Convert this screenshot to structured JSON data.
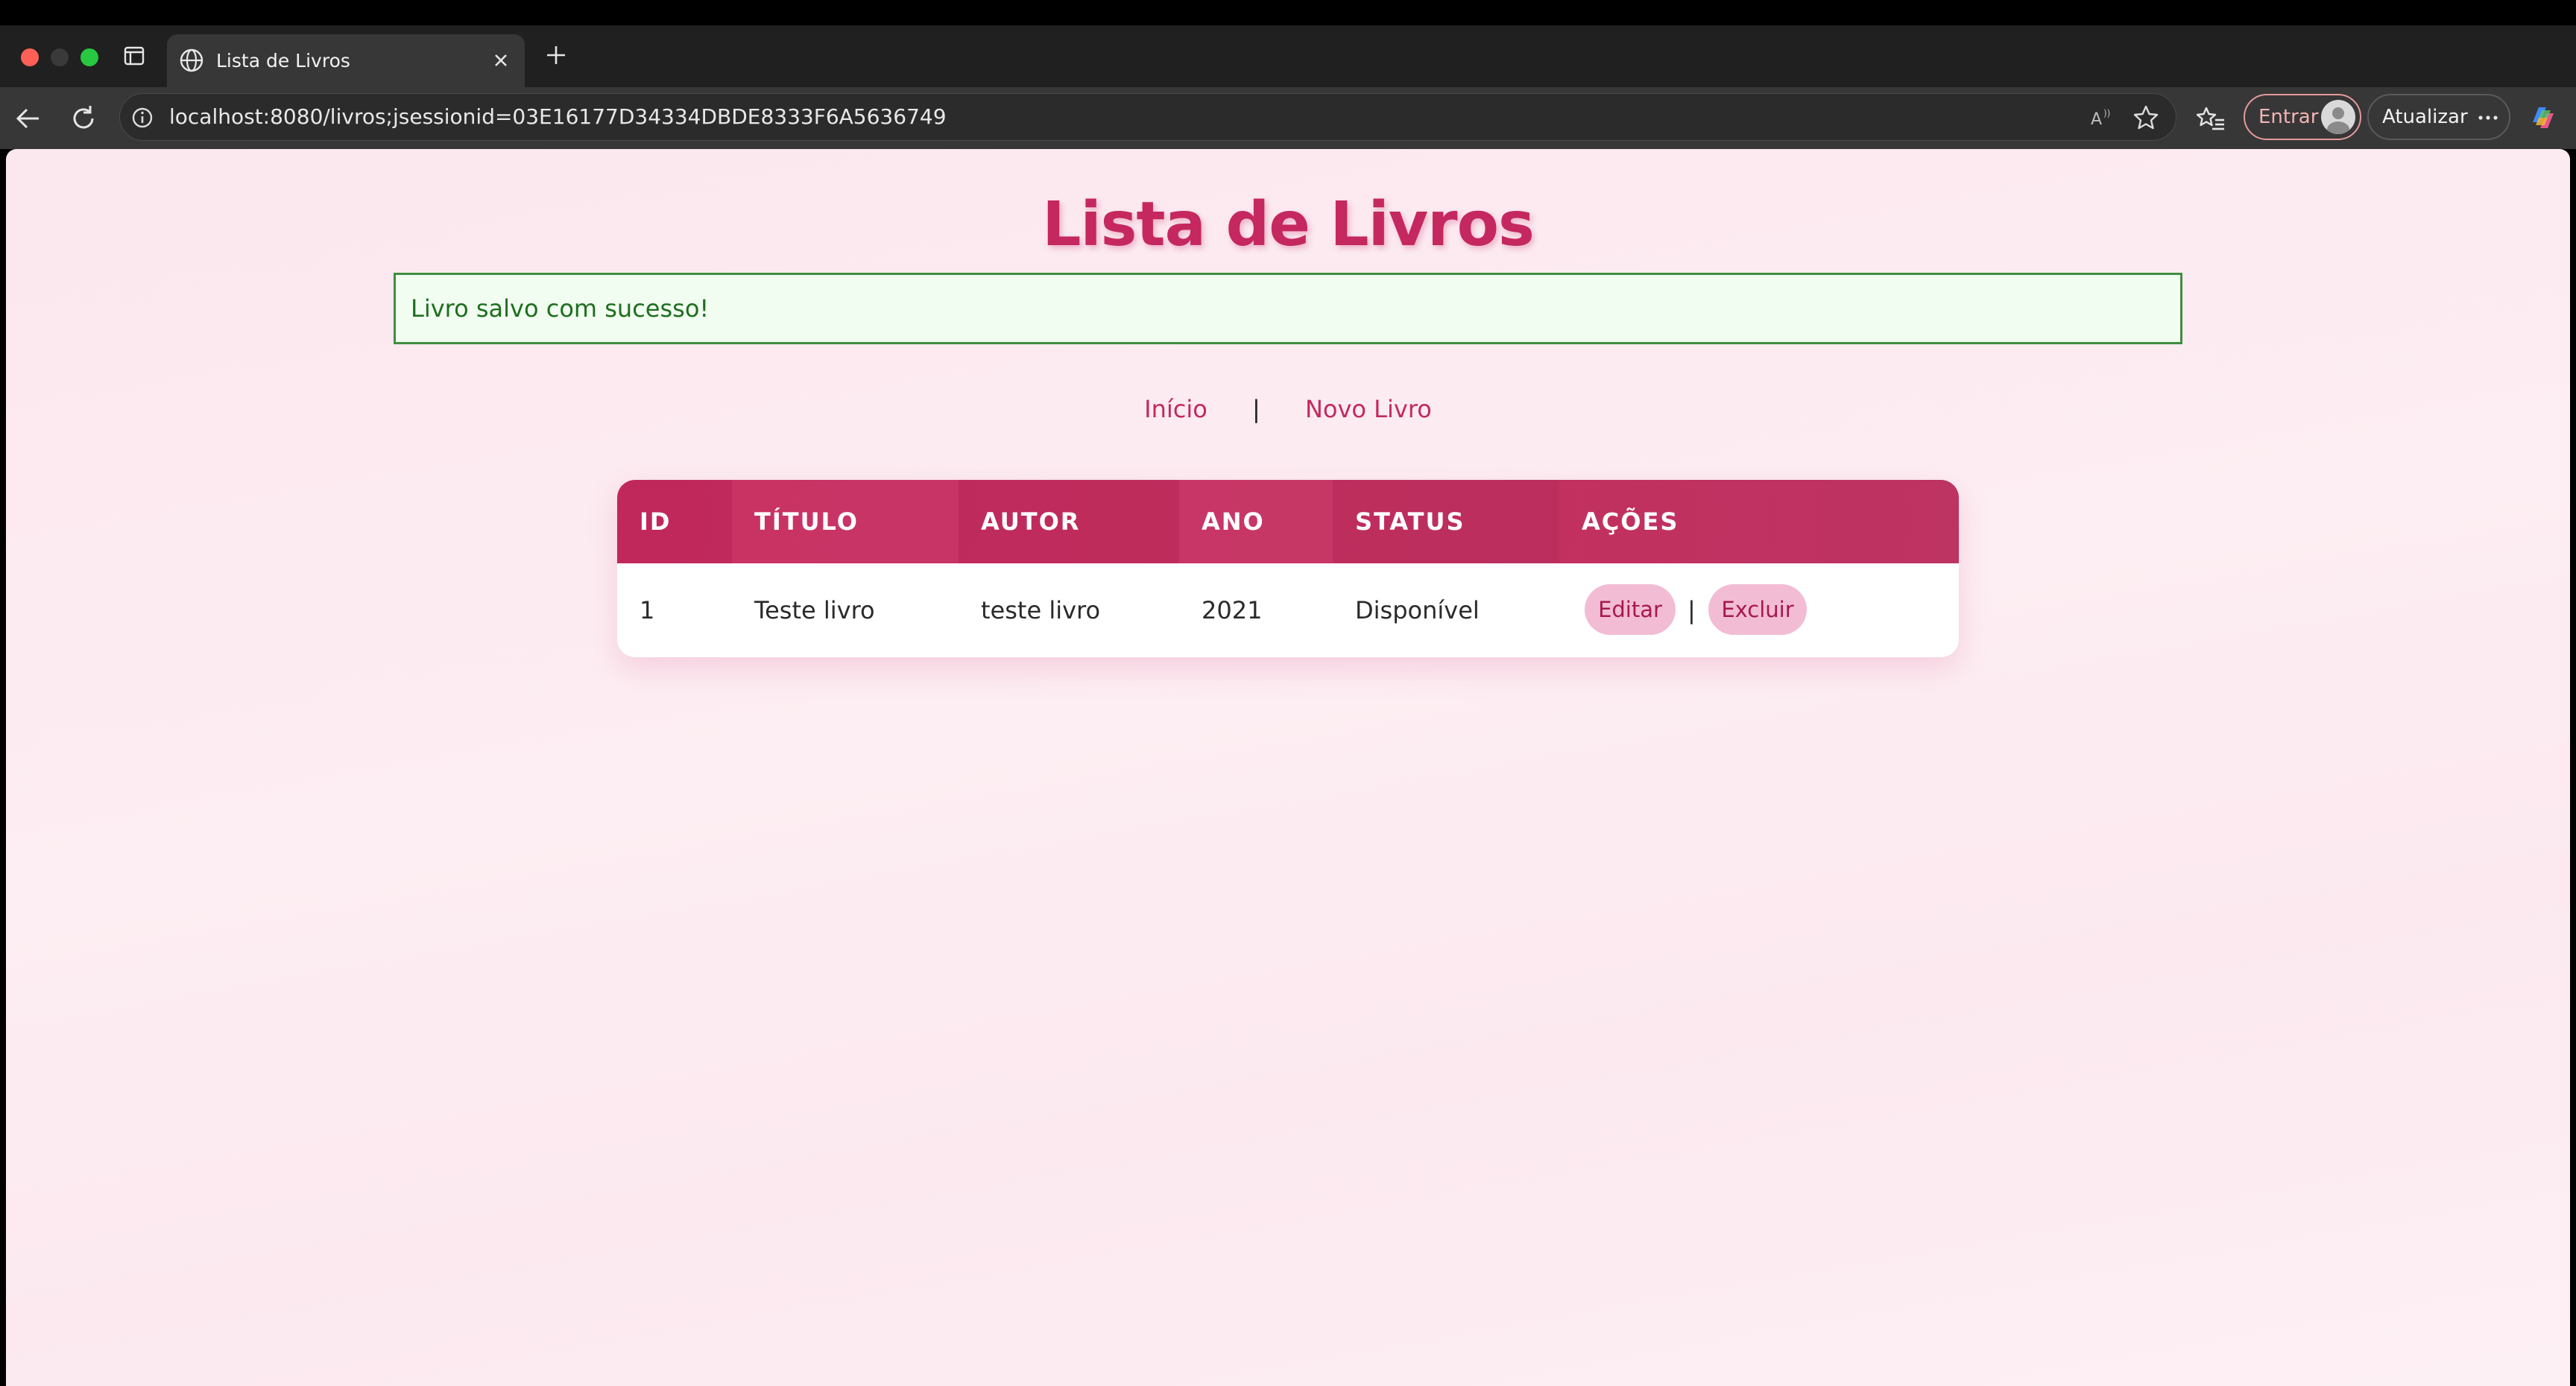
{
  "browser": {
    "tab_title": "Lista de Livros",
    "url": "localhost:8080/livros;jsessionid=03E16177D34334DBDE8333F6A5636749",
    "entrar_label": "Entrar",
    "atualizar_label": "Atualizar"
  },
  "page": {
    "title": "Lista de Livros",
    "alert": "Livro salvo com sucesso!",
    "nav": {
      "inicio": "Início",
      "separator": "|",
      "novo_livro": "Novo Livro"
    }
  },
  "table": {
    "columns": [
      "ID",
      "TÍTULO",
      "AUTOR",
      "ANO",
      "STATUS",
      "AÇÕES"
    ],
    "rows": [
      {
        "id": "1",
        "titulo": "Teste livro",
        "autor": "teste livro",
        "ano": "2021",
        "status": "Disponível",
        "editar": "Editar",
        "separator": "|",
        "excluir": "Excluir"
      }
    ]
  },
  "colors": {
    "accent": "#c4285f",
    "alert_text": "#1e6e1e",
    "alert_border": "#3f8f3f",
    "pill_bg": "#f2bcd4"
  }
}
